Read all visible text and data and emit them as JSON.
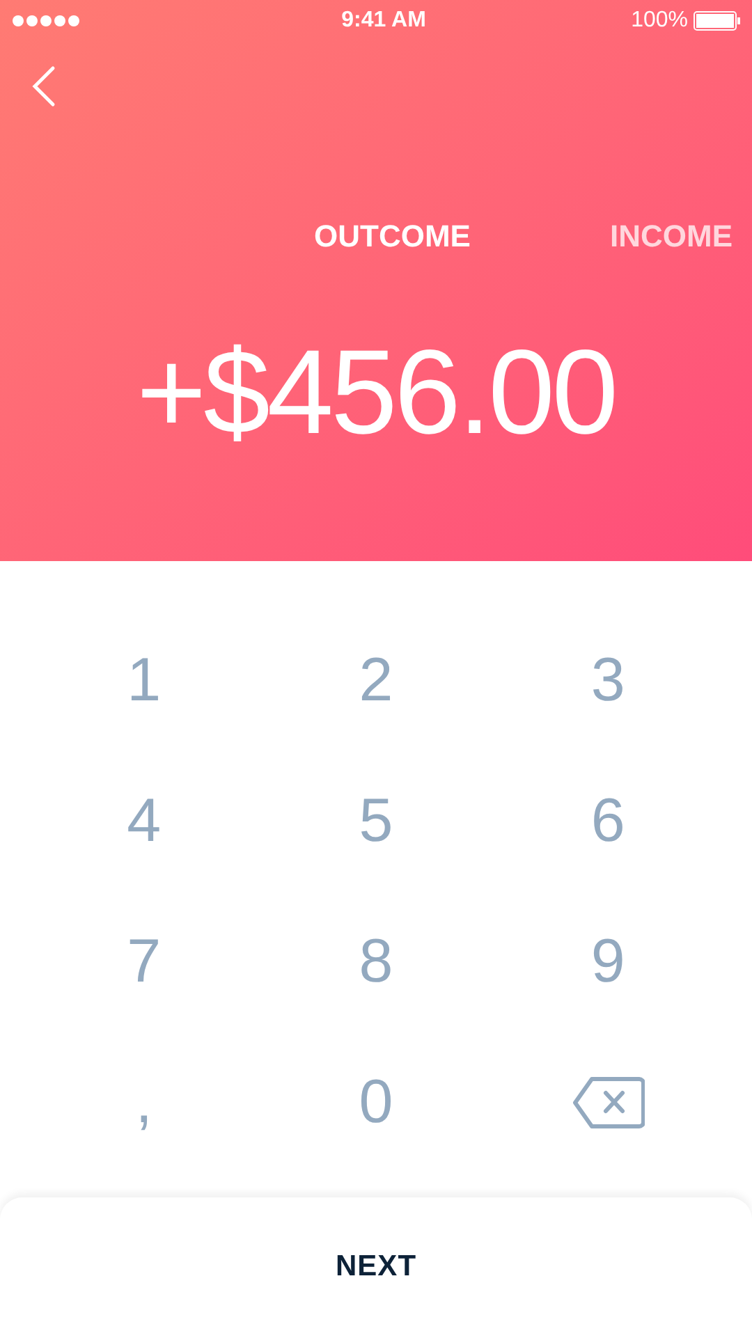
{
  "status_bar": {
    "time": "9:41 AM",
    "battery": "100%"
  },
  "tabs": [
    {
      "label": "OUTCOME",
      "selected": true
    },
    {
      "label": "INCOME",
      "selected": false
    }
  ],
  "amount": "+$456.00",
  "keypad": [
    {
      "kind": "key",
      "label": "1"
    },
    {
      "kind": "key",
      "label": "2"
    },
    {
      "kind": "key",
      "label": "3"
    },
    {
      "kind": "key",
      "label": "4"
    },
    {
      "kind": "key",
      "label": "5"
    },
    {
      "kind": "key",
      "label": "6"
    },
    {
      "kind": "key",
      "label": "7"
    },
    {
      "kind": "key",
      "label": "8"
    },
    {
      "kind": "key",
      "label": "9"
    },
    {
      "kind": "key",
      "label": ","
    },
    {
      "kind": "key",
      "label": "0"
    },
    {
      "kind": "backspace"
    }
  ],
  "next_button": "NEXT"
}
